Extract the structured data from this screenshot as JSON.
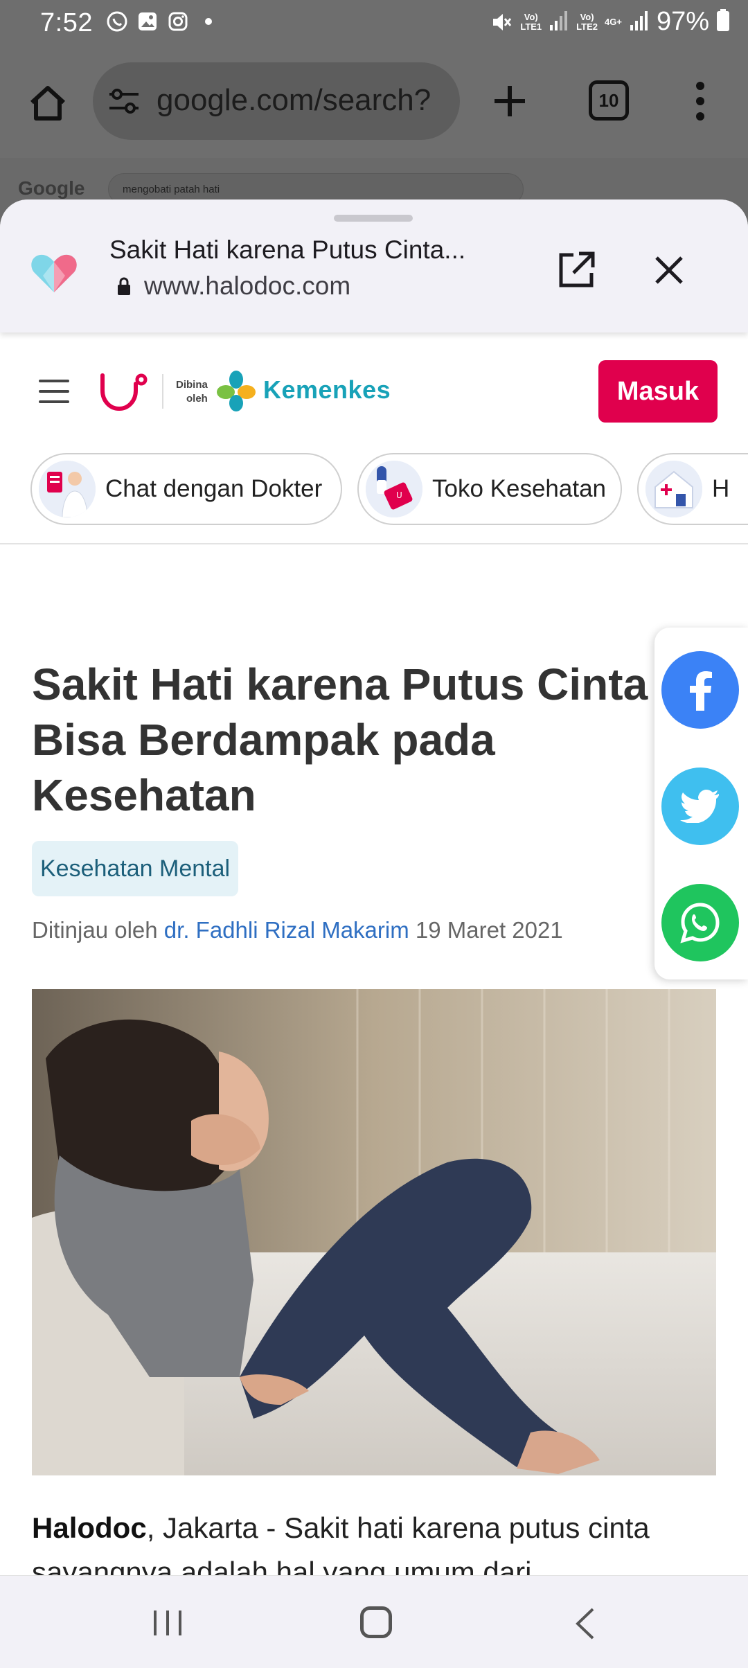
{
  "status_bar": {
    "time": "7:52",
    "battery": "97%",
    "sim1": "LTE1",
    "sim2": "LTE2",
    "net2": "4G+"
  },
  "browser": {
    "url": "google.com/search?",
    "tab_count": "10"
  },
  "background_page": {
    "google_logo": "Google",
    "search_query": "mengobati patah hati"
  },
  "sheet": {
    "title": "Sakit Hati karena Putus Cinta...",
    "domain": "www.halodoc.com"
  },
  "site": {
    "dibina": "Dibina",
    "oleh": "oleh",
    "kemenkes": "Kemenkes",
    "login": "Masuk",
    "pills": [
      {
        "label": "Chat dengan Dokter"
      },
      {
        "label": "Toko Kesehatan"
      },
      {
        "label": "H"
      }
    ]
  },
  "article": {
    "headline": "Sakit Hati karena Putus Cinta Bisa Berdampak pada Kesehatan",
    "category": "Kesehatan Mental",
    "reviewed_prefix": "Ditinjau oleh",
    "doctor": "dr. Fadhli Rizal Makarim",
    "date": "19 Maret 2021",
    "lead_source": "Halodoc",
    "lead_text": ", Jakarta - Sakit hati karena putus cinta sayangnya adalah hal yang umum dari"
  },
  "share": {
    "facebook": "f"
  },
  "colors": {
    "brand": "#e0004d",
    "facebook": "#3b82f6",
    "twitter": "#3fbfef",
    "whatsapp": "#1fc55e",
    "kemenkes": "#18a2b8"
  }
}
